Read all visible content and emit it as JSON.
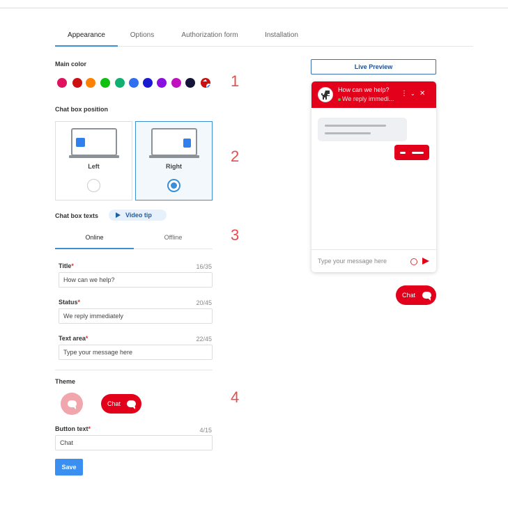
{
  "tabs": [
    "Appearance",
    "Options",
    "Authorization form",
    "Installation"
  ],
  "main_color": {
    "label": "Main color",
    "swatches": [
      "#e0115f",
      "#cc1010",
      "#ff7f00",
      "#10c010",
      "#10b070",
      "#2f6ff0",
      "#1a1ad0",
      "#8a10e0",
      "#c010c0",
      "#15153a"
    ],
    "selected": "#cc1010"
  },
  "steps": [
    "1",
    "2",
    "3",
    "4"
  ],
  "position": {
    "label": "Chat box position",
    "options": [
      "Left",
      "Right"
    ],
    "selected": "Right"
  },
  "texts": {
    "label": "Chat box texts",
    "video_tip": "Video tip",
    "tabs": [
      "Online",
      "Offline"
    ],
    "fields": [
      {
        "label": "Title",
        "counter": "16/35",
        "value": "How can we help?"
      },
      {
        "label": "Status",
        "counter": "20/45",
        "value": "We reply immediately"
      },
      {
        "label": "Text area",
        "counter": "22/45",
        "value": "Type your message here"
      }
    ]
  },
  "theme": {
    "label": "Theme",
    "pill_text": "Chat"
  },
  "button_text": {
    "label": "Button text",
    "counter": "4/15",
    "value": "Chat"
  },
  "save": "Save",
  "preview": {
    "live_preview": "Live Preview",
    "title": "How can we help?",
    "status": "We reply immedi...",
    "input_placeholder": "Type your message here",
    "launcher": "Chat"
  }
}
